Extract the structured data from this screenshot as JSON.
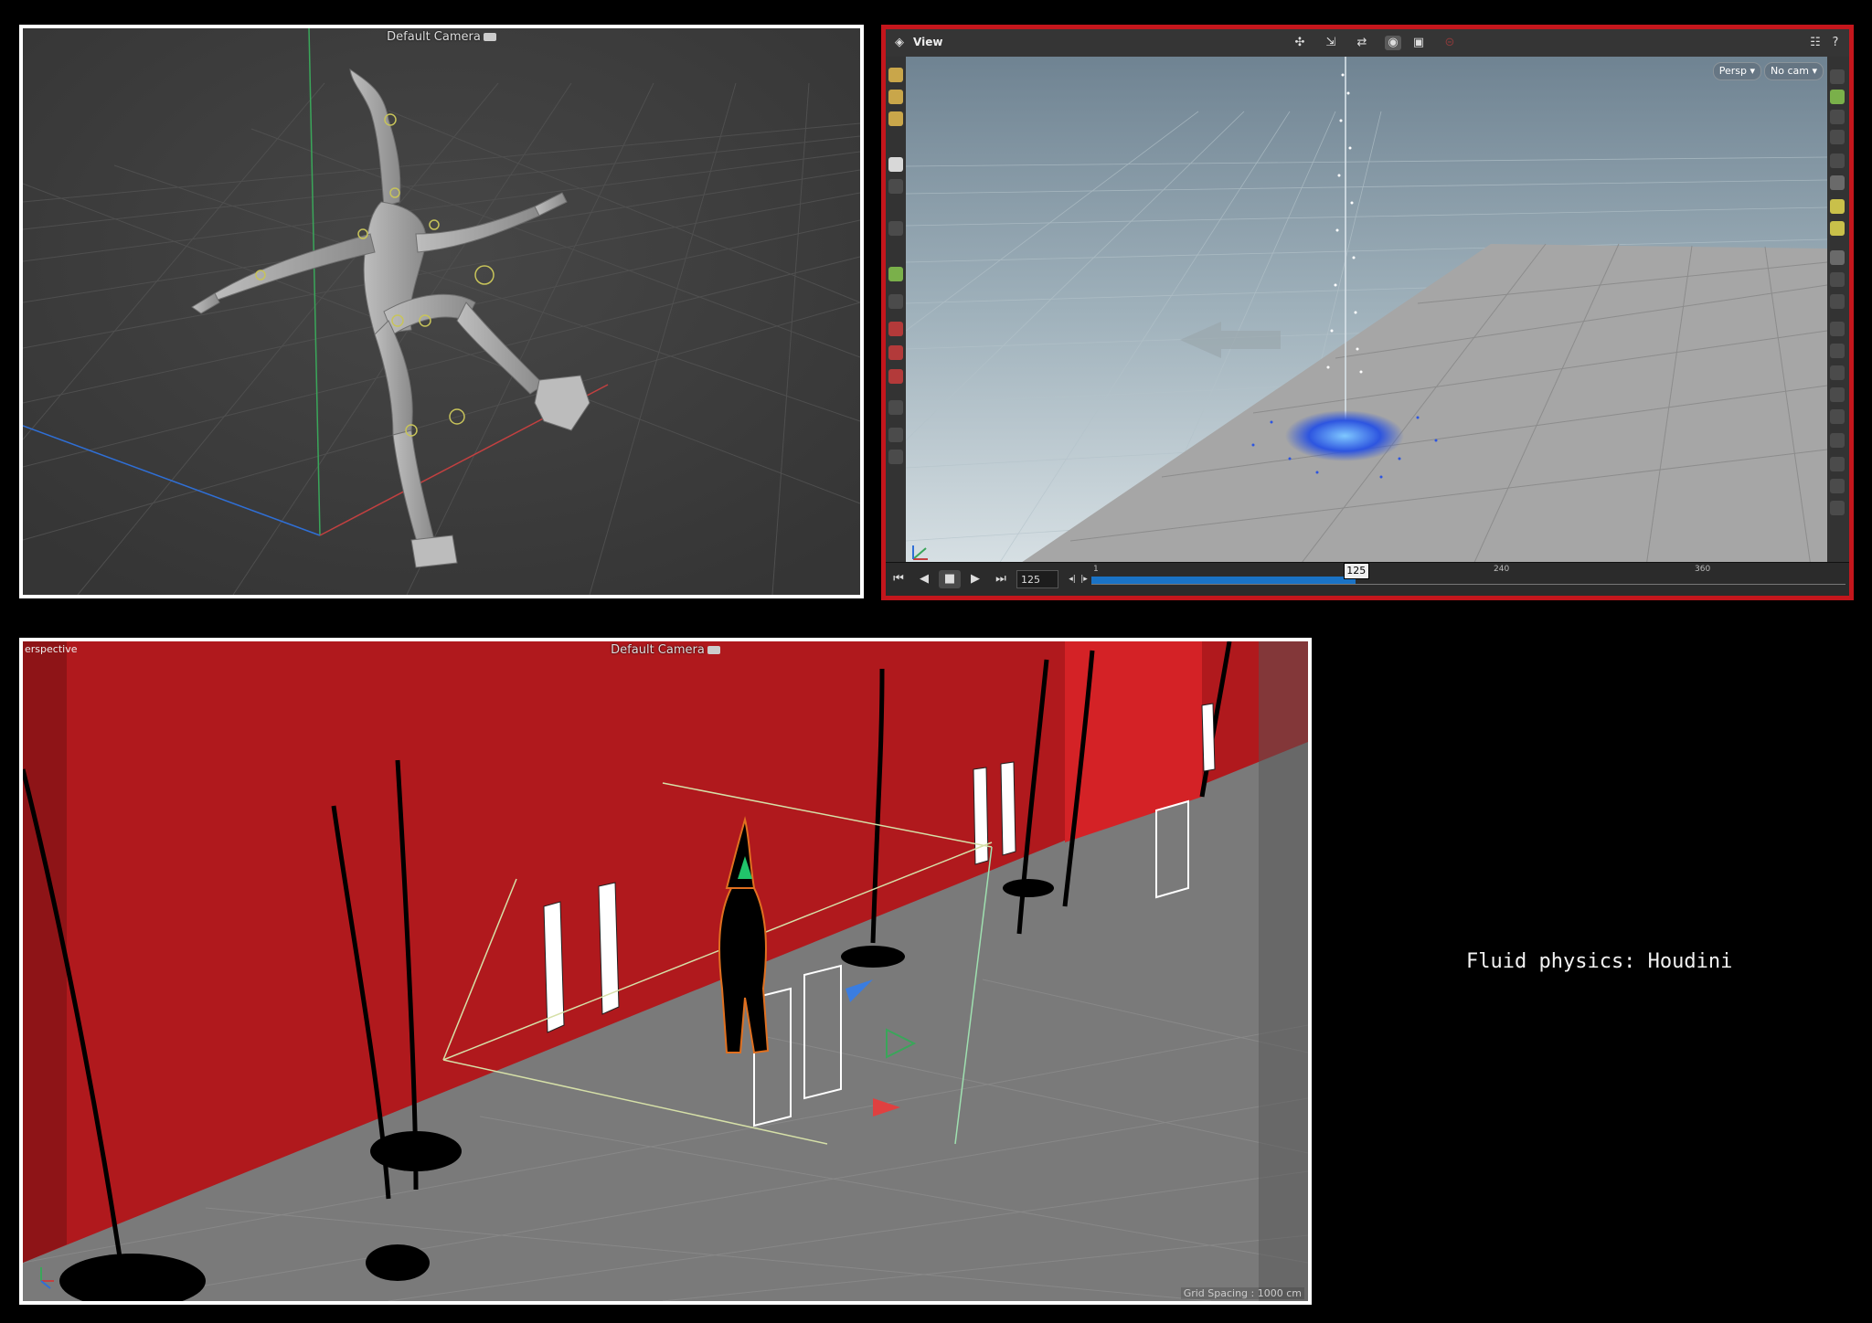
{
  "panels": {
    "rig": {
      "camera_label": "Default Camera"
    },
    "houdini": {
      "menu_title": "View",
      "persp_button": "Persp",
      "cam_button": "No cam",
      "timeline": {
        "current_frame": "125",
        "marker_label": "125",
        "ticks": [
          "1",
          "240",
          "360"
        ],
        "progress_fraction": 0.35
      },
      "accent_color": "#c4161c"
    },
    "scene": {
      "corner_label": "erspective",
      "camera_label": "Default Camera",
      "grid_spacing": "Grid Spacing : 1000 cm"
    }
  },
  "caption": "Fluid physics: Houdini"
}
